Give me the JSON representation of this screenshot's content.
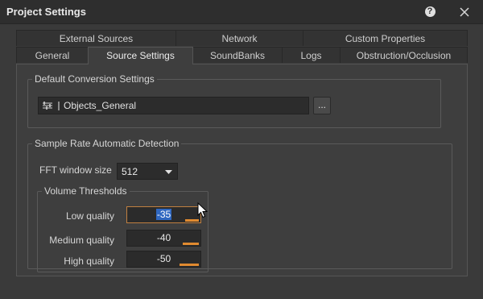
{
  "window": {
    "title": "Project Settings"
  },
  "tabs": {
    "row1": [
      "External Sources",
      "Network",
      "Custom Properties"
    ],
    "row2": [
      "General",
      "Source Settings",
      "SoundBanks",
      "Logs",
      "Obstruction/Occlusion"
    ],
    "active": "Source Settings"
  },
  "conversion": {
    "legend": "Default Conversion Settings",
    "value": "Objects_General",
    "browse_label": "..."
  },
  "detection": {
    "legend": "Sample Rate Automatic Detection",
    "fft_label": "FFT window size",
    "fft_value": "512",
    "thresholds": {
      "legend": "Volume Thresholds",
      "items": [
        {
          "label": "Low quality",
          "value": "-35",
          "level": 0.35
        },
        {
          "label": "Medium quality",
          "value": "-40",
          "level": 0.4
        },
        {
          "label": "High quality",
          "value": "-50",
          "level": 0.5
        }
      ]
    }
  },
  "colors": {
    "accent": "#e08a30",
    "selection": "#2f67c0"
  }
}
